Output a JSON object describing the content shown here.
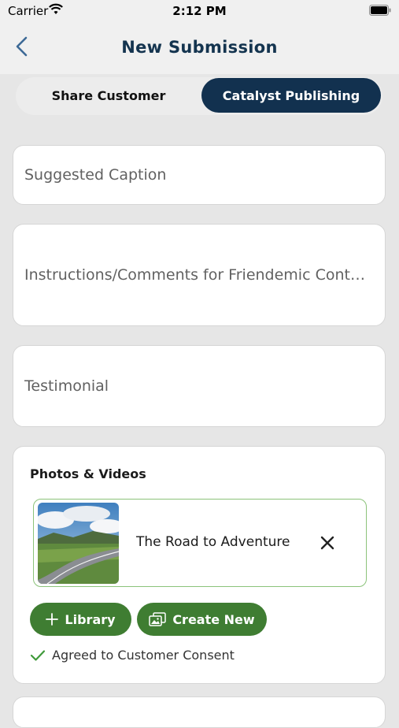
{
  "status_bar": {
    "carrier": "Carrier",
    "time": "2:12 PM"
  },
  "nav": {
    "title": "New Submission"
  },
  "segments": {
    "left_label": "Share Customer",
    "right_label": "Catalyst Publishing",
    "selected": "Catalyst Publishing"
  },
  "fields": {
    "caption_placeholder": "Suggested Caption",
    "instructions_placeholder": "Instructions/Comments for Friendemic Conten...",
    "testimonial_placeholder": "Testimonial"
  },
  "media": {
    "title": "Photos & Videos",
    "items": [
      {
        "name": "The Road to Adventure"
      }
    ],
    "library_label": "Library",
    "create_new_label": "Create New",
    "consent_text": "Agreed to Customer Consent"
  },
  "colors": {
    "primary_navy": "#12314f",
    "accent_green": "#3f7d32",
    "item_border": "#8bc37a"
  }
}
